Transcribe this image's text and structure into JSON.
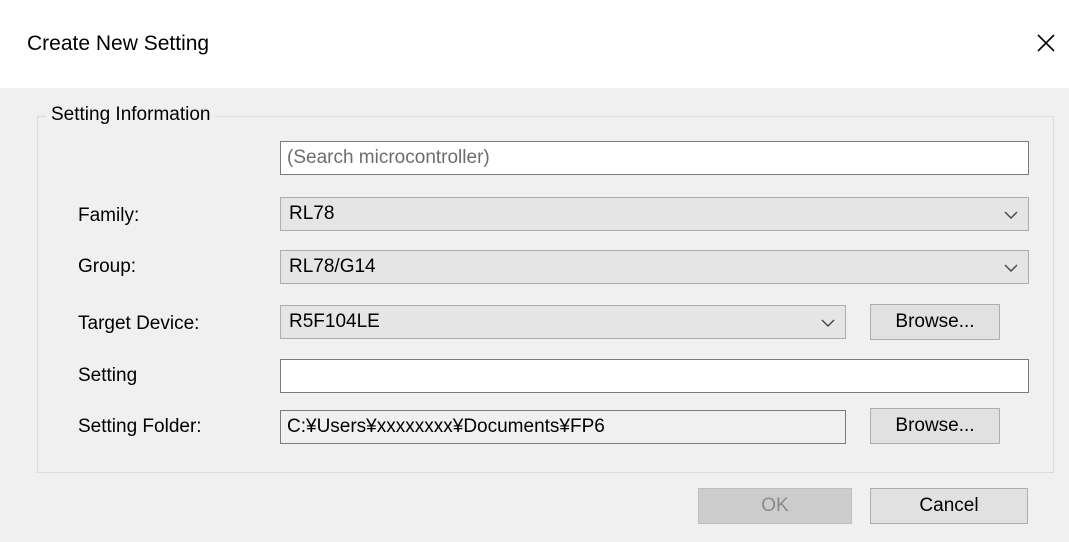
{
  "dialog": {
    "title": "Create New Setting"
  },
  "group": {
    "legend": "Setting Information"
  },
  "search": {
    "placeholder": "(Search microcontroller)",
    "value": ""
  },
  "fields": {
    "family_label": "Family:",
    "family_value": "RL78",
    "group_label": "Group:",
    "group_value": "RL78/G14",
    "target_label": "Target Device:",
    "target_value": "R5F104LE",
    "setting_label": "Setting",
    "setting_value": "",
    "folder_label": "Setting Folder:",
    "folder_value": "C:¥Users¥xxxxxxxx¥Documents¥FP6"
  },
  "buttons": {
    "browse_device": "Browse...",
    "browse_folder": "Browse...",
    "ok": "OK",
    "cancel": "Cancel"
  },
  "colors": {
    "title_bg": "#ffffff",
    "dialog_bg": "#f0f0f0",
    "combo_bg": "#e5e5e5",
    "button_bg": "#e1e1e1",
    "disabled_button_bg": "#cccccc"
  },
  "icons": {
    "close": "close-icon",
    "dropdown": "chevron-down-icon"
  }
}
